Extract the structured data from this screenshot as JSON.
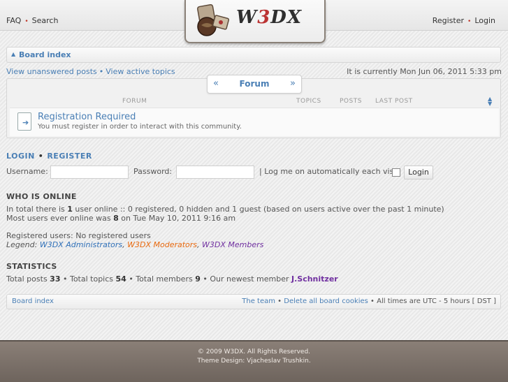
{
  "topbar": {
    "faq": "FAQ",
    "search": "Search",
    "register": "Register",
    "login": "Login",
    "sep": "•"
  },
  "logo": {
    "text_a": "W",
    "text_b": "3",
    "text_c": "DX"
  },
  "breadcrumb": {
    "label": "Board index"
  },
  "subnav": {
    "unanswered": "View unanswered posts",
    "sep": "•",
    "active": "View active topics",
    "datetime": "It is currently Mon Jun 06, 2011 5:33 pm"
  },
  "forum": {
    "tab_title": "Forum",
    "tab_left": "«",
    "tab_right": "»",
    "col_forum": "FORUM",
    "col_topics": "TOPICS",
    "col_posts": "POSTS",
    "col_lastpost": "LAST POST",
    "sort_arrows": "▲▼",
    "row_title": "Registration Required",
    "row_desc": "You must register in order to interact with this community."
  },
  "login": {
    "title_login": "LOGIN",
    "title_sep": "•",
    "title_register": "REGISTER",
    "username_label": "Username:",
    "password_label": "Password:",
    "autologin_label": "| Log me on automatically each visit",
    "button": "Login"
  },
  "online": {
    "title": "WHO IS ONLINE",
    "line1_a": "In total there is ",
    "line1_n": "1",
    "line1_b": " user online :: 0 registered, 0 hidden and 1 guest (based on users active over the past 1 minute)",
    "line2_a": "Most users ever online was ",
    "line2_n": "8",
    "line2_b": " on Tue May 10, 2011 9:16 am",
    "registered": "Registered users: No registered users",
    "legend_label": "Legend: ",
    "legend_admin": "W3DX Administrators",
    "legend_mod": "W3DX Moderators",
    "legend_member": "W3DX Members",
    "comma": ", "
  },
  "stats": {
    "title": "STATISTICS",
    "a": "Total posts ",
    "posts": "33",
    "b": " • Total topics ",
    "topics": "54",
    "c": " • Total members ",
    "members": "9",
    "d": " • Our newest member ",
    "newest": "J.Schnitzer"
  },
  "footnav": {
    "board": "Board index",
    "team": "The team",
    "sep1": " • ",
    "cookies": "Delete all board cookies",
    "sep2": " • ",
    "times": "All times are UTC - 5 hours [ DST ]"
  },
  "copyright": {
    "line1": "© 2009 W3DX. All Rights Reserved.",
    "line2": "Theme Design: Vjacheslav Trushkin."
  },
  "colors": {
    "link": "#4a7fb5",
    "admin": "#3070b8",
    "moderator": "#e86a10",
    "member": "#7030a0",
    "footer": "#7a6f68"
  }
}
